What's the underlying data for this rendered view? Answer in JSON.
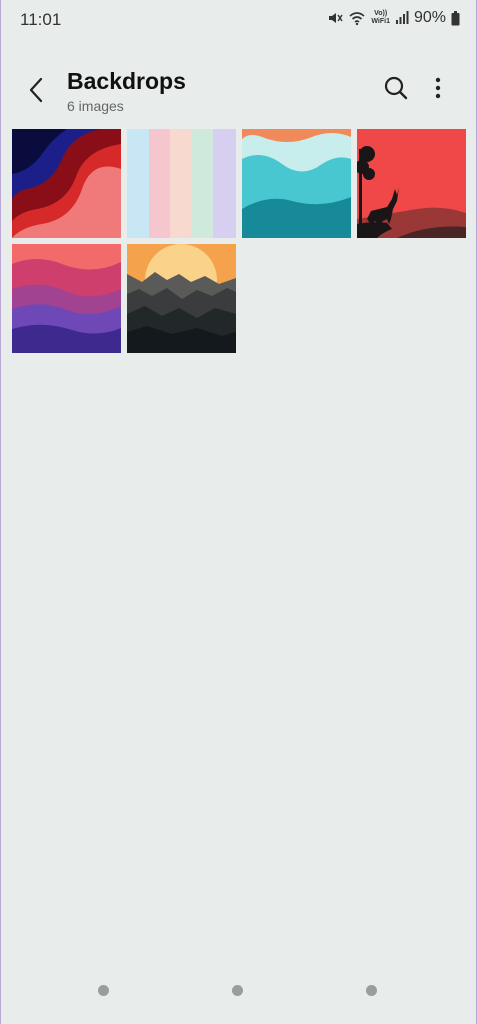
{
  "status_bar": {
    "time": "11:01",
    "volte_top": "Vo))",
    "volte_bottom": "WiFi1",
    "battery": "90%"
  },
  "app_bar": {
    "title": "Backdrops",
    "subtitle": "6 images",
    "back_icon": "chevron-left-icon",
    "search_icon": "search-icon",
    "more_icon": "more-vertical-icon"
  },
  "images": [
    {
      "name": "red-blue-waves",
      "colors": [
        "#0c0f4a",
        "#7a0f1a",
        "#d62a2a",
        "#f06a6a"
      ]
    },
    {
      "name": "pastel-stripes",
      "colors": [
        "#c9e6f5",
        "#f5c6cd",
        "#f8d9cf",
        "#f6e0d0",
        "#c8e8da",
        "#d7cff0"
      ]
    },
    {
      "name": "teal-waves",
      "colors": [
        "#f08a5a",
        "#c7eeec",
        "#48c7d0",
        "#168a99"
      ]
    },
    {
      "name": "deer-silhouette",
      "colors": [
        "#f04848",
        "#1a1516",
        "#6b3a3a"
      ]
    },
    {
      "name": "purple-waves",
      "colors": [
        "#f26a6a",
        "#cf3f6e",
        "#8b48b8",
        "#3e2a8e"
      ]
    },
    {
      "name": "sunset-mountains",
      "colors": [
        "#f4a24c",
        "#fbd28a",
        "#5a5a58",
        "#14191d"
      ]
    }
  ]
}
